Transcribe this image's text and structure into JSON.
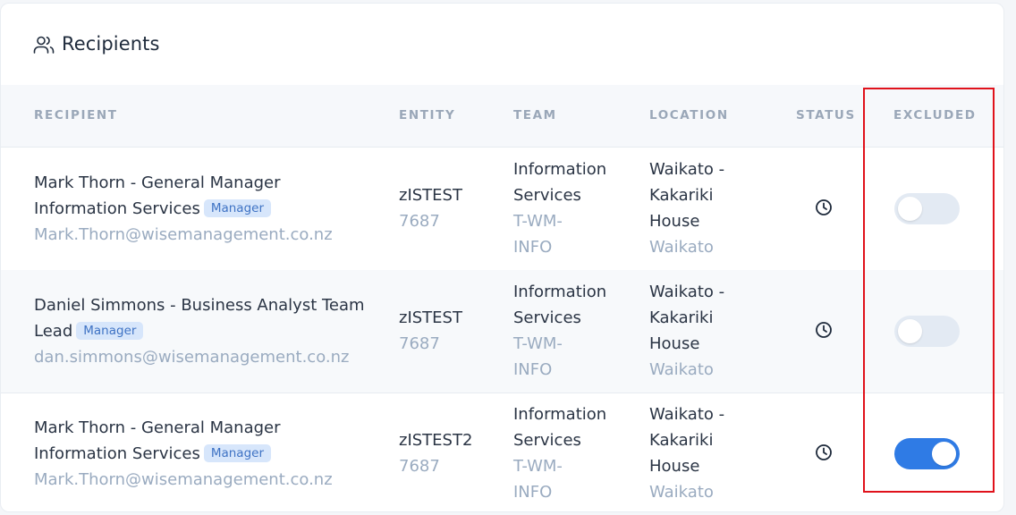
{
  "card": {
    "title": "Recipients",
    "icon": "users-icon"
  },
  "table": {
    "headers": {
      "recipient": "RECIPIENT",
      "entity": "ENTITY",
      "team": "TEAM",
      "location": "LOCATION",
      "status": "STATUS",
      "excluded": "EXCLUDED"
    },
    "rows": [
      {
        "name_line1": "Mark Thorn - General Manager",
        "name_line2": "Information Services",
        "badge": "Manager",
        "email": "Mark.Thorn@wisemanagement.co.nz",
        "entity_name": "zISTEST",
        "entity_code": "7687",
        "team_line1": "Information",
        "team_line2": "Services",
        "team_code_line1": "T-WM-",
        "team_code_line2": "INFO",
        "location_line1": "Waikato -",
        "location_line2": "Kakariki",
        "location_line3": "House",
        "location_region": "Waikato",
        "status_icon": "clock-icon",
        "excluded": false
      },
      {
        "name_line1": "Daniel Simmons - Business Analyst Team",
        "name_line2": "Lead",
        "badge": "Manager",
        "email": "dan.simmons@wisemanagement.co.nz",
        "entity_name": "zISTEST",
        "entity_code": "7687",
        "team_line1": "Information",
        "team_line2": "Services",
        "team_code_line1": "T-WM-",
        "team_code_line2": "INFO",
        "location_line1": "Waikato -",
        "location_line2": "Kakariki",
        "location_line3": "House",
        "location_region": "Waikato",
        "status_icon": "clock-icon",
        "excluded": false
      },
      {
        "name_line1": "Mark Thorn - General Manager",
        "name_line2": "Information Services",
        "badge": "Manager",
        "email": "Mark.Thorn@wisemanagement.co.nz",
        "entity_name": "zISTEST2",
        "entity_code": "7687",
        "team_line1": "Information",
        "team_line2": "Services",
        "team_code_line1": "T-WM-",
        "team_code_line2": "INFO",
        "location_line1": "Waikato -",
        "location_line2": "Kakariki",
        "location_line3": "House",
        "location_region": "Waikato",
        "status_icon": "clock-icon",
        "excluded": true
      }
    ]
  },
  "colors": {
    "toggle_on": "#2f7be5",
    "toggle_off": "#e3eaf3",
    "badge_bg": "#d7e6fb",
    "badge_text": "#3f73c4",
    "highlight": "#e0121b"
  }
}
